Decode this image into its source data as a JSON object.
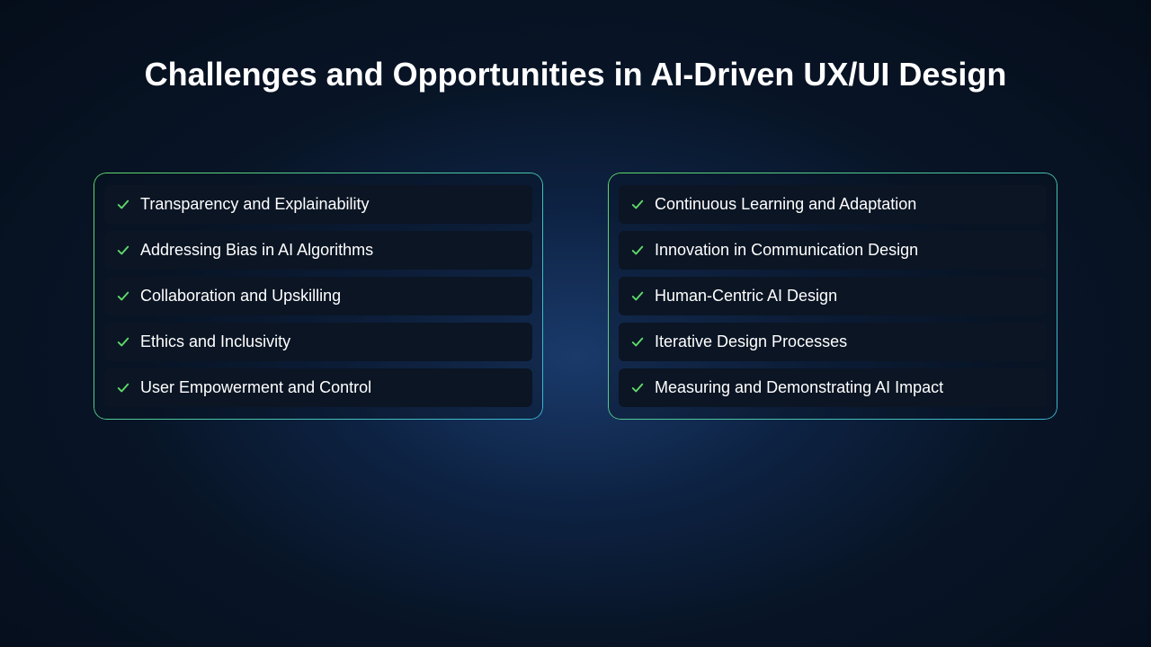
{
  "title": "Challenges and Opportunities in AI-Driven UX/UI Design",
  "left_list": {
    "items": [
      {
        "label": "Transparency and Explainability"
      },
      {
        "label": "Addressing Bias in AI Algorithms"
      },
      {
        "label": "Collaboration and Upskilling"
      },
      {
        "label": "Ethics and Inclusivity"
      },
      {
        "label": "User Empowerment and Control"
      }
    ]
  },
  "right_list": {
    "items": [
      {
        "label": "Continuous Learning and Adaptation"
      },
      {
        "label": "Innovation in Communication Design"
      },
      {
        "label": "Human-Centric AI Design"
      },
      {
        "label": "Iterative Design Processes"
      },
      {
        "label": "Measuring and Demonstrating AI Impact"
      }
    ]
  },
  "colors": {
    "accent_green": "#5fd96a",
    "accent_cyan": "#3bb6d8",
    "bg_dark": "#050d1a",
    "item_bg": "#0b1524"
  }
}
